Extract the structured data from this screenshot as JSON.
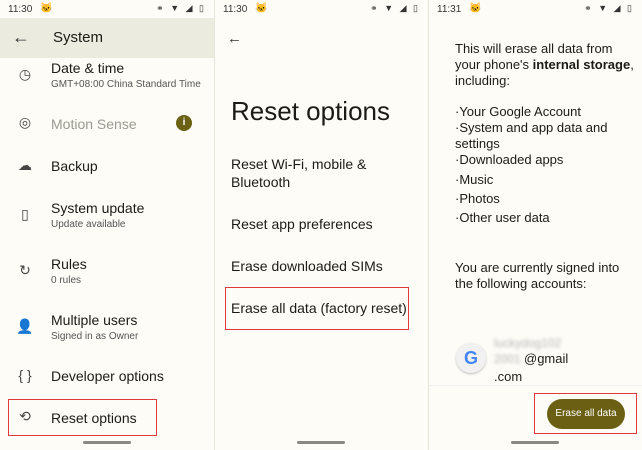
{
  "status_bar_1": {
    "time": "11:30"
  },
  "status_bar_2": {
    "time": "11:30"
  },
  "status_bar_3": {
    "time": "11:31"
  },
  "system_screen": {
    "title": "System",
    "items": [
      {
        "label": "Date & time",
        "sub": "GMT+08:00 China Standard Time",
        "icon": "clock-icon"
      },
      {
        "label": "Motion Sense",
        "sub": "",
        "icon": "motion-sense-icon",
        "disabled": true
      },
      {
        "label": "Backup",
        "sub": "",
        "icon": "cloud-upload-icon"
      },
      {
        "label": "System update",
        "sub": "Update available",
        "icon": "phone-update-icon"
      },
      {
        "label": "Rules",
        "sub": "0 rules",
        "icon": "rules-icon"
      },
      {
        "label": "Multiple users",
        "sub": "Signed in as Owner",
        "icon": "person-icon"
      },
      {
        "label": "Developer options",
        "sub": "",
        "icon": "braces-icon"
      },
      {
        "label": "Reset options",
        "sub": "",
        "icon": "history-icon"
      }
    ]
  },
  "reset_screen": {
    "title": "Reset options",
    "items": [
      {
        "label": "Reset Wi-Fi, mobile & Bluetooth"
      },
      {
        "label": "Reset app preferences"
      },
      {
        "label": "Erase downloaded SIMs"
      },
      {
        "label": "Erase all data (factory reset)"
      }
    ]
  },
  "erase_screen": {
    "intro_part1": "This will erase all data from your phone's ",
    "intro_bold": "internal storage",
    "intro_part2": ", including:",
    "list": [
      "·Your Google Account",
      "·System and app data and settings",
      "·Downloaded apps",
      "·Music",
      "·Photos",
      "·Other user data"
    ],
    "signed_in_text": "You are currently signed into the following accounts:",
    "account_blurred_1": "luckydog102",
    "account_blurred_2": "2001",
    "account_domain": "@gmail",
    "account_tld": ".com",
    "button_label": "Erase all data"
  },
  "colors": {
    "accent": "#6b5f13",
    "highlight_border": "#e0393b"
  }
}
